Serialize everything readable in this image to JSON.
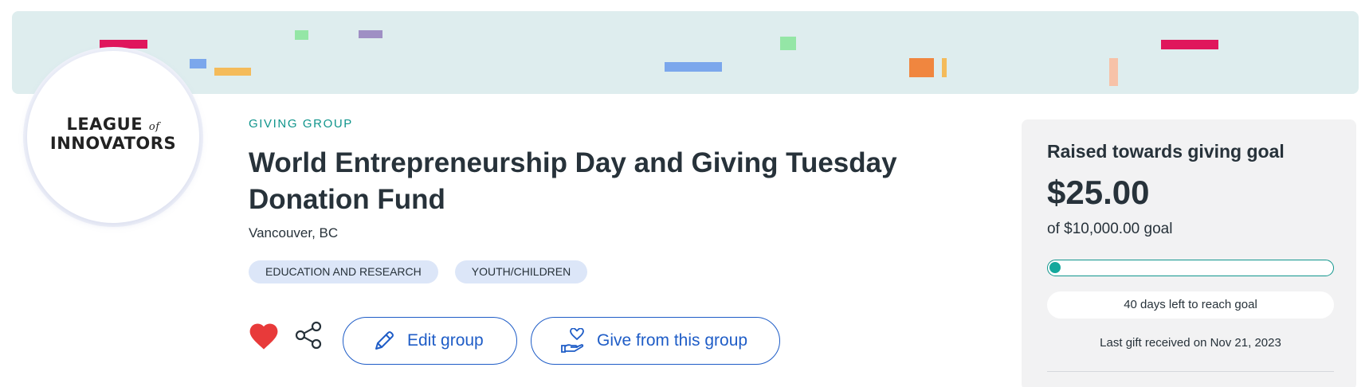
{
  "banner": {
    "background_color": "#deedee"
  },
  "logo": {
    "line1": "LEAGUE",
    "of": "of",
    "line2": "INNOVATORS"
  },
  "group": {
    "eyebrow": "GIVING GROUP",
    "title": "World Entrepreneurship Day and Giving Tuesday Donation Fund",
    "location": "Vancouver, BC",
    "tags": [
      "EDUCATION AND RESEARCH",
      "YOUTH/CHILDREN"
    ]
  },
  "actions": {
    "favorite_icon": "heart-icon",
    "share_icon": "share-icon",
    "edit_label": "Edit group",
    "edit_icon": "pencil-icon",
    "give_label": "Give from this group",
    "give_icon": "hand-heart-icon"
  },
  "goal": {
    "label": "Raised towards giving goal",
    "amount": "$25.00",
    "of_goal": "of $10,000.00 goal",
    "progress_fraction": 0.0025,
    "days_left": "40 days left to reach goal",
    "last_gift": "Last gift received on Nov 21, 2023"
  },
  "colors": {
    "accent_teal": "#10958c",
    "button_blue": "#1f5dc7",
    "heart_red": "#e83a3a",
    "tag_bg": "#dce6f8"
  }
}
